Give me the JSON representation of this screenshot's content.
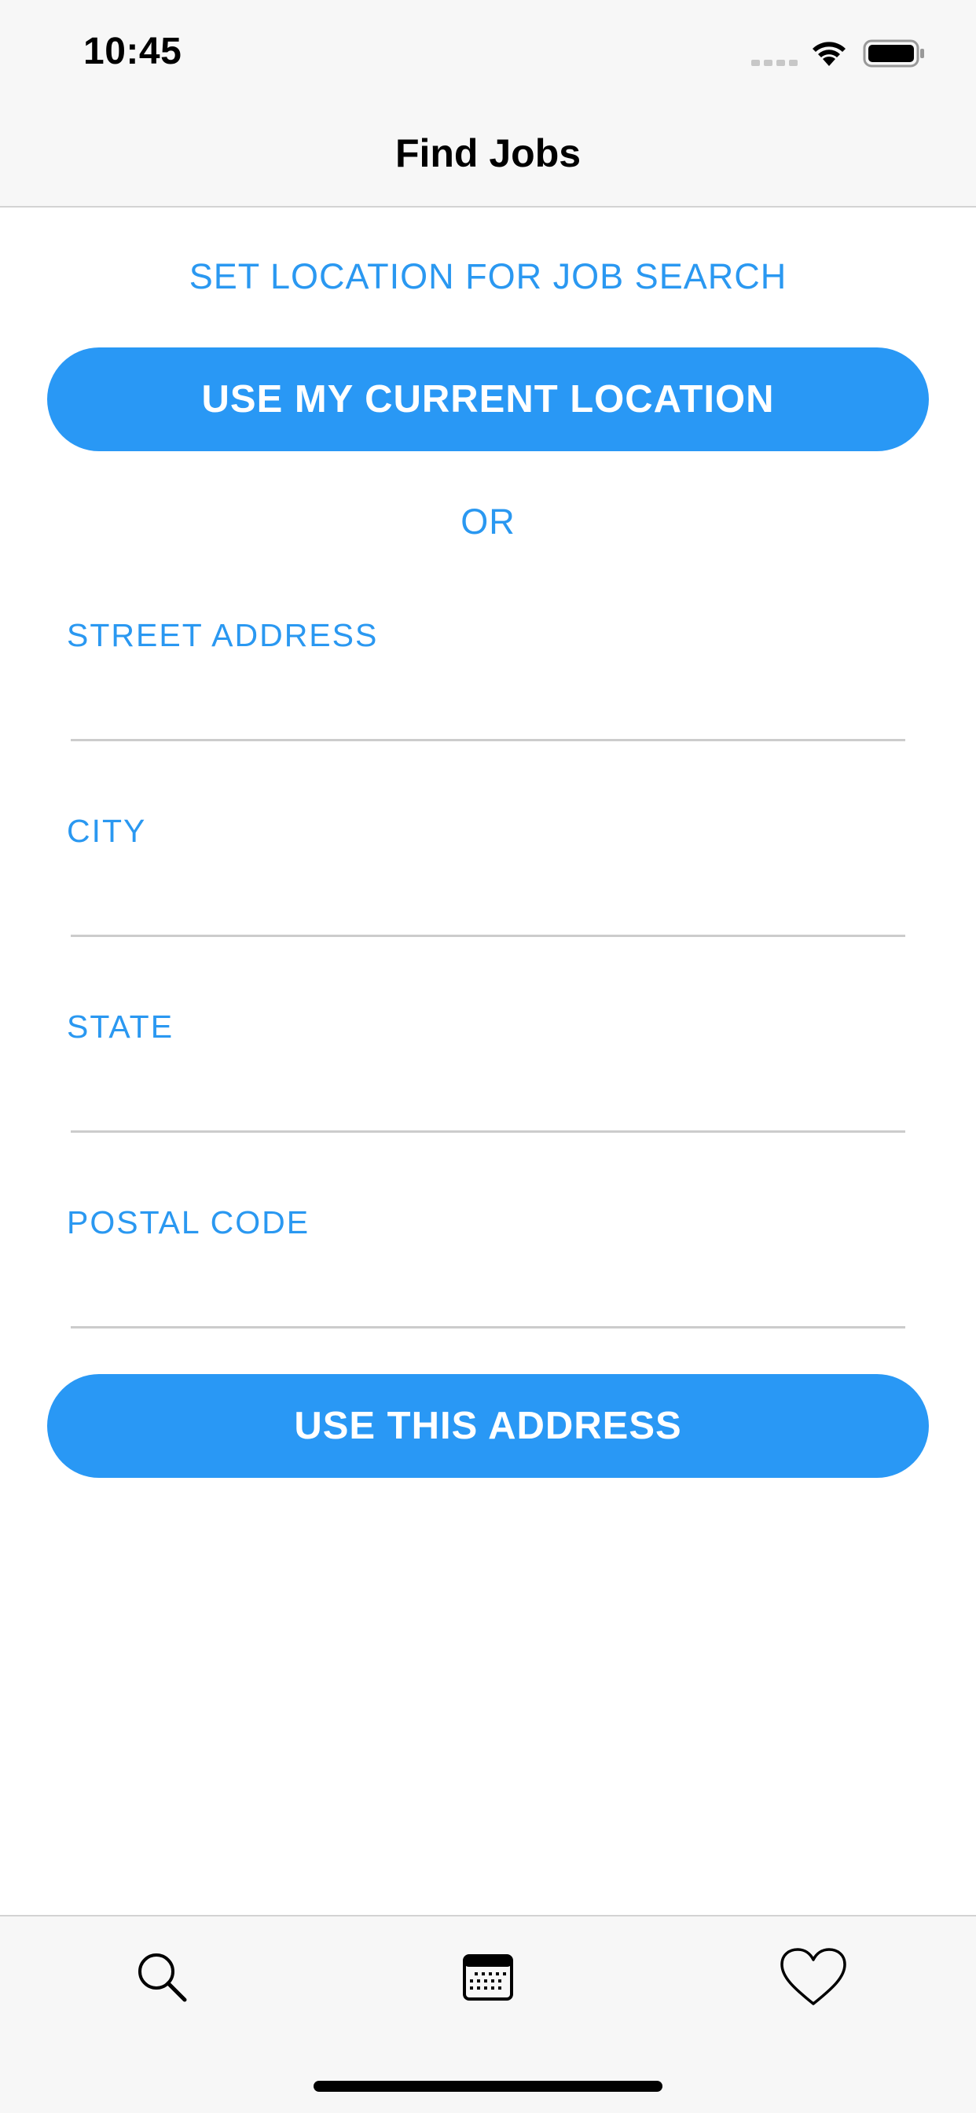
{
  "status_bar": {
    "time": "10:45",
    "signal_icon": "cellular-signal-icon",
    "wifi_icon": "wifi-icon",
    "battery_icon": "battery-icon"
  },
  "nav": {
    "title": "Find Jobs"
  },
  "location": {
    "heading": "SET LOCATION FOR JOB SEARCH",
    "current_location_button": "USE MY CURRENT LOCATION",
    "or_label": "OR"
  },
  "fields": {
    "street": {
      "label": "STREET ADDRESS",
      "value": "",
      "placeholder": ""
    },
    "city": {
      "label": "CITY",
      "value": "",
      "placeholder": ""
    },
    "state": {
      "label": "STATE",
      "value": "",
      "placeholder": ""
    },
    "postal": {
      "label": "POSTAL CODE",
      "value": "",
      "placeholder": ""
    }
  },
  "use_address_button": "USE THIS ADDRESS",
  "tabs": [
    {
      "icon": "search-icon"
    },
    {
      "icon": "calendar-icon"
    },
    {
      "icon": "heart-icon"
    }
  ],
  "colors": {
    "accent": "#2998f5",
    "accent_text": "#2a98f1",
    "bar_background": "#f7f7f7",
    "divider": "#cccccc"
  }
}
